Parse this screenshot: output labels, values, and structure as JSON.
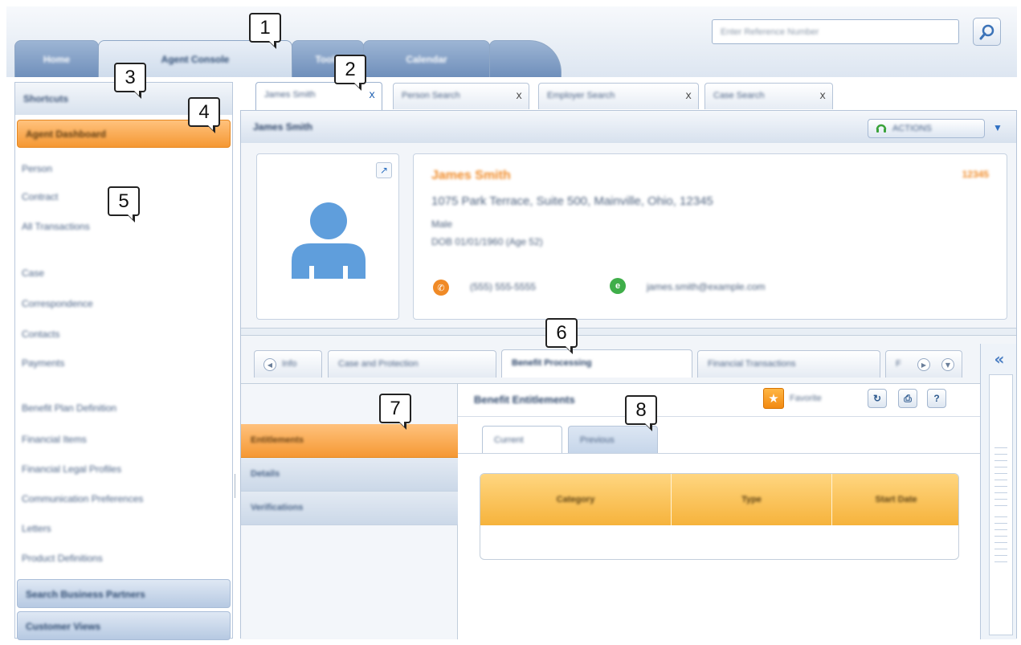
{
  "header": {
    "nav_tabs": [
      "Home",
      "Agent Console",
      "Tools",
      "Calendar",
      ""
    ],
    "search_placeholder": "Enter Reference Number"
  },
  "sidebar": {
    "title": "Shortcuts",
    "selected": "Agent Dashboard",
    "links": [
      "Person",
      "Contract",
      "All Transactions",
      "Case",
      "Correspondence",
      "Contacts",
      "Payments",
      "Benefit Plan Definition",
      "Financial Items",
      "Financial Legal Profiles",
      "Communication Preferences",
      "Letters",
      "Product Definitions"
    ],
    "bottom_items": [
      "Search Business Partners",
      "Customer Views"
    ]
  },
  "doc_tabs": [
    "James Smith",
    "Person Search",
    "Employer Search",
    "Case Search"
  ],
  "profile": {
    "header_title": "James Smith",
    "actions_label": "ACTIONS",
    "name": "James Smith",
    "id": "12345",
    "address": "1075 Park Terrace, Suite 500, Mainville, Ohio, 12345",
    "gender": "Male",
    "dob": "DOB 01/01/1960 (Age 52)",
    "phone": "(555) 555-5555",
    "email": "james.smith@example.com"
  },
  "subtabs": [
    "Info",
    "Case and Protection",
    "Benefit Processing",
    "Financial Transactions",
    "F"
  ],
  "sub_nav": [
    "Entitlements",
    "Details",
    "Verifications"
  ],
  "detail": {
    "title": "Benefit Entitlements",
    "star_label": "Favorite",
    "refresh": "↻",
    "print": "⎙",
    "help": "?",
    "inner_tabs": [
      "Current",
      "Previous"
    ],
    "columns": [
      "Category",
      "Type",
      "Start Date"
    ]
  },
  "callouts": [
    "1",
    "2",
    "3",
    "4",
    "5",
    "6",
    "7",
    "8"
  ]
}
